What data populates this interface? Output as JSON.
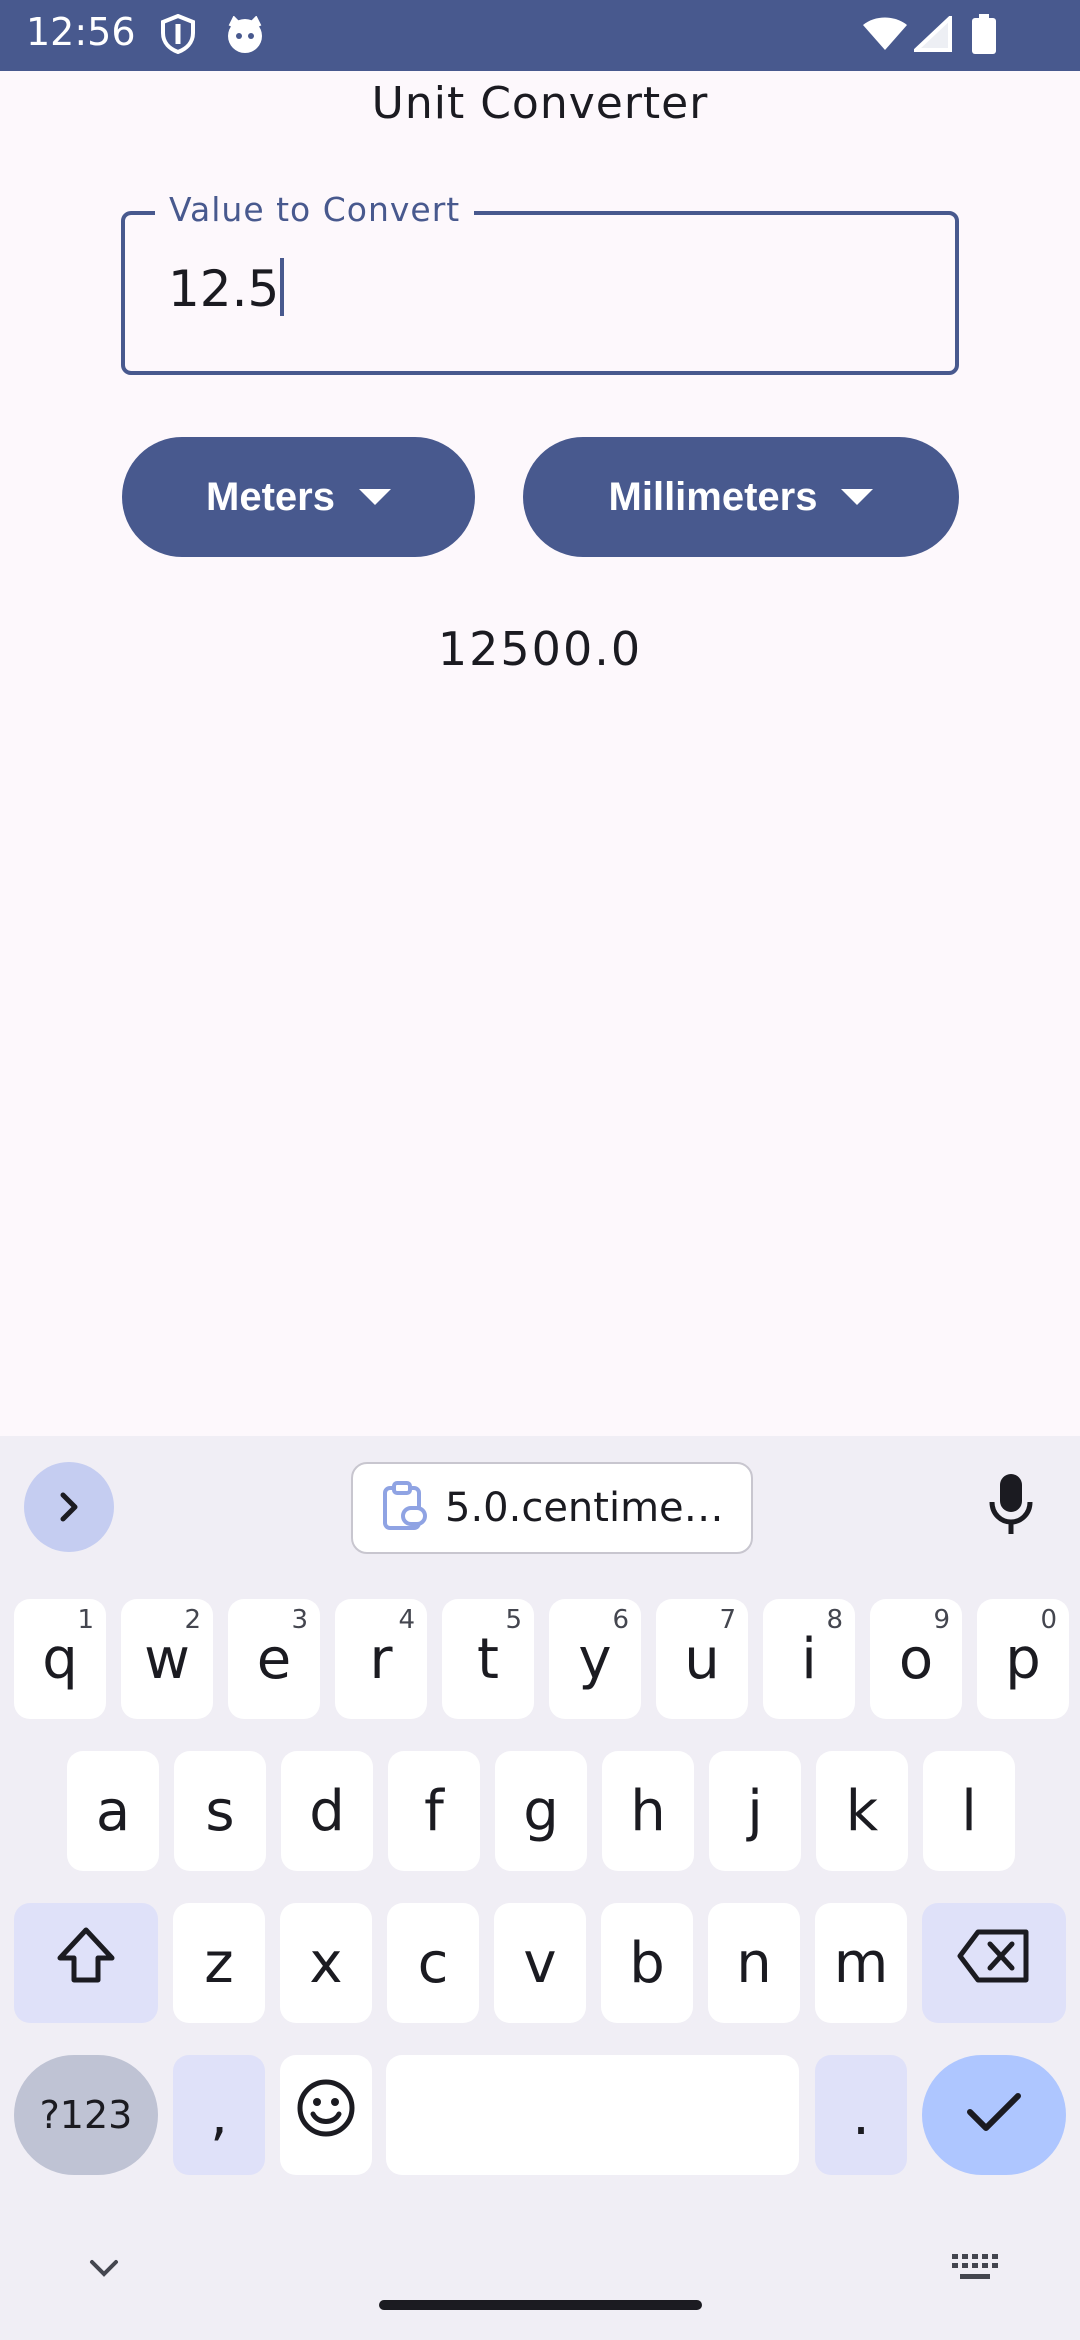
{
  "status_bar": {
    "time": "12:56"
  },
  "app": {
    "title": "Unit Converter",
    "input_label": "Value to Convert",
    "input_value": "12.5",
    "from_unit": "Meters",
    "to_unit": "Millimeters",
    "result": "12500.0"
  },
  "keyboard": {
    "clipboard_suggestion": "5.0.centime…",
    "row1": [
      {
        "key": "q",
        "hint": "1"
      },
      {
        "key": "w",
        "hint": "2"
      },
      {
        "key": "e",
        "hint": "3"
      },
      {
        "key": "r",
        "hint": "4"
      },
      {
        "key": "t",
        "hint": "5"
      },
      {
        "key": "y",
        "hint": "6"
      },
      {
        "key": "u",
        "hint": "7"
      },
      {
        "key": "i",
        "hint": "8"
      },
      {
        "key": "o",
        "hint": "9"
      },
      {
        "key": "p",
        "hint": "0"
      }
    ],
    "row2": [
      "a",
      "s",
      "d",
      "f",
      "g",
      "h",
      "j",
      "k",
      "l"
    ],
    "row3": [
      "z",
      "x",
      "c",
      "v",
      "b",
      "n",
      "m"
    ],
    "symbols_label": "?123",
    "comma": ",",
    "period": "."
  },
  "colors": {
    "primary": "#48598e",
    "background": "#fdf8fc",
    "keyboard_bg": "#f0eef5"
  },
  "icons": [
    "shield-icon",
    "cat-icon",
    "wifi-icon",
    "signal-icon",
    "battery-icon",
    "chevron-right-icon",
    "clipboard-icon",
    "mic-icon",
    "shift-icon",
    "backspace-icon",
    "emoji-icon",
    "check-icon",
    "chevron-down-icon",
    "keyboard-icon"
  ]
}
